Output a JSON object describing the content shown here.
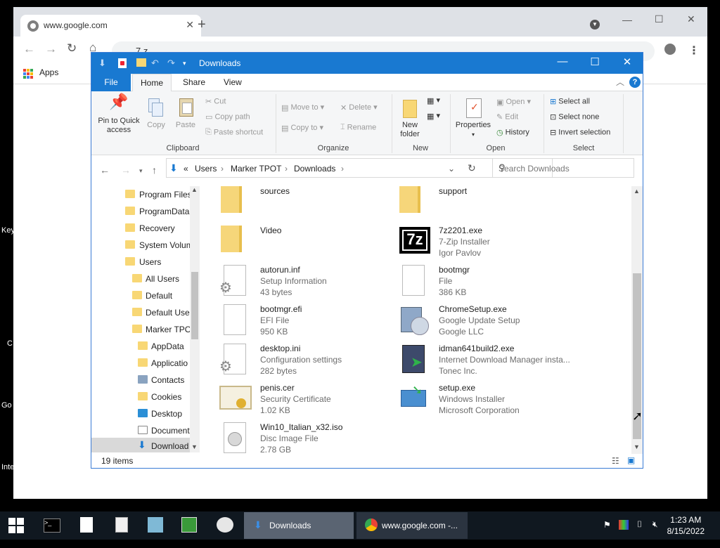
{
  "desktop": {
    "edge_labels": [
      "Key",
      "C",
      "Go",
      "Inte"
    ]
  },
  "chrome": {
    "tab_title": "www.google.com",
    "omnibox_text": "7 z",
    "bookmarks_apps": "Apps"
  },
  "explorer": {
    "title": "Downloads",
    "ribbon_tabs": {
      "file": "File",
      "home": "Home",
      "share": "Share",
      "view": "View"
    },
    "clipboard": {
      "pin_label": "Pin to Quick access",
      "copy_label": "Copy",
      "paste_label": "Paste",
      "cut_label": "Cut",
      "copy_path_label": "Copy path",
      "paste_shortcut_label": "Paste shortcut",
      "group_label": "Clipboard"
    },
    "organize": {
      "move_to": "Move to",
      "copy_to": "Copy to",
      "delete": "Delete",
      "rename": "Rename",
      "group_label": "Organize"
    },
    "new_group": {
      "new_folder": "New folder",
      "group_label": "New"
    },
    "open_group": {
      "properties": "Properties",
      "open": "Open",
      "edit": "Edit",
      "history": "History",
      "group_label": "Open"
    },
    "select_group": {
      "select_all": "Select all",
      "select_none": "Select none",
      "invert": "Invert selection",
      "group_label": "Select"
    },
    "address": {
      "prefix": "«",
      "crumbs": [
        "Users",
        "Marker TPOT",
        "Downloads"
      ],
      "search_placeholder": "Search Downloads"
    },
    "nav_items": [
      {
        "label": "Program Files",
        "level": 0
      },
      {
        "label": "ProgramData",
        "level": 0
      },
      {
        "label": "Recovery",
        "level": 0
      },
      {
        "label": "System Volum",
        "level": 0
      },
      {
        "label": "Users",
        "level": 0
      },
      {
        "label": "All Users",
        "level": 1
      },
      {
        "label": "Default",
        "level": 1
      },
      {
        "label": "Default User",
        "level": 1
      },
      {
        "label": "Marker TPOT",
        "level": 1
      },
      {
        "label": "AppData",
        "level": 2
      },
      {
        "label": "Applicatio",
        "level": 2
      },
      {
        "label": "Contacts",
        "level": 2
      },
      {
        "label": "Cookies",
        "level": 2
      },
      {
        "label": "Desktop",
        "level": 2
      },
      {
        "label": "Document",
        "level": 2
      },
      {
        "label": "Download",
        "level": 2
      }
    ],
    "items": [
      {
        "name": "sources",
        "l1": "",
        "l2": "",
        "icon": "folder-icon"
      },
      {
        "name": "support",
        "l1": "",
        "l2": "",
        "icon": "folder-icon"
      },
      {
        "name": "Video",
        "l1": "",
        "l2": "",
        "icon": "folder-icon"
      },
      {
        "name": "7z2201.exe",
        "l1": "7-Zip Installer",
        "l2": "Igor Pavlov",
        "icon": "7zip-icon"
      },
      {
        "name": "autorun.inf",
        "l1": "Setup Information",
        "l2": "43 bytes",
        "icon": "settings-file-icon"
      },
      {
        "name": "bootmgr",
        "l1": "File",
        "l2": "386 KB",
        "icon": "blank-file-icon"
      },
      {
        "name": "bootmgr.efi",
        "l1": "EFI File",
        "l2": "950 KB",
        "icon": "blank-file-icon"
      },
      {
        "name": "ChromeSetup.exe",
        "l1": "Google Update Setup",
        "l2": "Google LLC",
        "icon": "installer-icon"
      },
      {
        "name": "desktop.ini",
        "l1": "Configuration settings",
        "l2": "282 bytes",
        "icon": "settings-file-icon"
      },
      {
        "name": "idman641build2.exe",
        "l1": "Internet Download Manager insta...",
        "l2": "Tonec Inc.",
        "icon": "idm-icon"
      },
      {
        "name": "penis.cer",
        "l1": "Security Certificate",
        "l2": "1.02 KB",
        "icon": "certificate-icon"
      },
      {
        "name": "setup.exe",
        "l1": "Windows Installer",
        "l2": "Microsoft Corporation",
        "icon": "windows-installer-icon"
      },
      {
        "name": "Win10_Italian_x32.iso",
        "l1": "Disc Image File",
        "l2": "2.78 GB",
        "icon": "disc-image-icon"
      }
    ],
    "status": "19 items"
  },
  "taskbar": {
    "windows": [
      {
        "label": "Downloads",
        "active": true
      },
      {
        "label": "www.google.com -...",
        "active": false
      }
    ],
    "time": "1:23 AM",
    "date": "8/15/2022"
  }
}
